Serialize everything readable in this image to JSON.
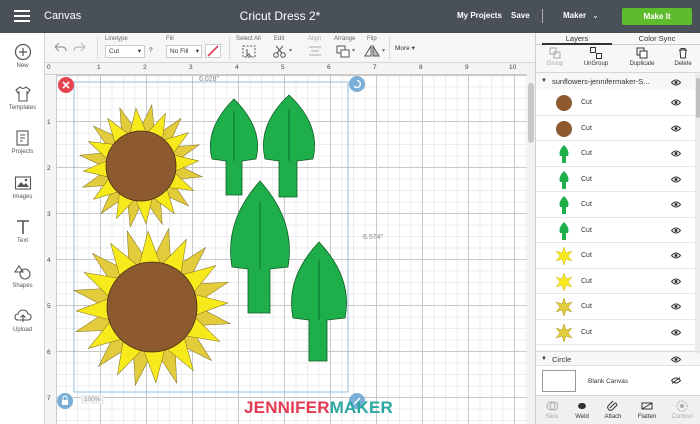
{
  "topbar": {
    "app_title": "Canvas",
    "doc_title": "Cricut Dress 2*",
    "my_projects": "My Projects",
    "save": "Save",
    "machine": "Maker",
    "make_it": "Make It"
  },
  "left_tools": [
    {
      "label": "New",
      "icon": "plus-circle-icon"
    },
    {
      "label": "Templates",
      "icon": "shirt-icon"
    },
    {
      "label": "Projects",
      "icon": "projects-icon"
    },
    {
      "label": "Images",
      "icon": "image-icon"
    },
    {
      "label": "Text",
      "icon": "text-icon"
    },
    {
      "label": "Shapes",
      "icon": "shapes-icon"
    },
    {
      "label": "Upload",
      "icon": "upload-icon"
    }
  ],
  "edit_bar": {
    "linetype_label": "Linetype",
    "linetype_value": "Cut",
    "help": "?",
    "fill_label": "Fill",
    "fill_value": "No Fill",
    "select_all_label": "Select All",
    "edit_label": "Edit",
    "align_label": "Align",
    "arrange_label": "Arrange",
    "flip_label": "Flip",
    "more_label": "More"
  },
  "ruler": {
    "top": [
      "1",
      "2",
      "3",
      "4",
      "5",
      "6",
      "7",
      "8",
      "9",
      "10"
    ],
    "left": [
      "0",
      "1",
      "2",
      "3",
      "4",
      "5",
      "6",
      "7"
    ]
  },
  "canvas": {
    "width_label": "6.028\"",
    "height_label": "6.574\"",
    "zoom": "100%"
  },
  "right_panel": {
    "tabs": [
      "Layers",
      "Color Sync"
    ],
    "actions": [
      "Group",
      "UnGroup",
      "Duplicate",
      "Delete"
    ],
    "group_name": "sunflowers-jennifermaker-S...",
    "layers": [
      {
        "name": "Cut",
        "thumb": "brown-circle"
      },
      {
        "name": "Cut",
        "thumb": "brown-circle"
      },
      {
        "name": "Cut",
        "thumb": "green-leaf"
      },
      {
        "name": "Cut",
        "thumb": "green-leaf"
      },
      {
        "name": "Cut",
        "thumb": "green-leaf"
      },
      {
        "name": "Cut",
        "thumb": "green-leaf"
      },
      {
        "name": "Cut",
        "thumb": "yellow-flower"
      },
      {
        "name": "Cut",
        "thumb": "yellow-flower"
      },
      {
        "name": "Cut",
        "thumb": "yellow-flower"
      },
      {
        "name": "Cut",
        "thumb": "yellow-flower"
      }
    ],
    "circle_group": "Circle",
    "blank_canvas": "Blank Canvas",
    "bottom_actions": [
      "Slice",
      "Weld",
      "Attach",
      "Flatten",
      "Contour"
    ]
  },
  "watermark": {
    "part_a": "JENNIFER",
    "part_b": "MAKER"
  },
  "colors": {
    "topbar": "#4a5058",
    "make_it": "#5dbb2c",
    "petal_yellow": "#f7ea1c",
    "petal_dark": "#e3cc3c",
    "center_brown": "#8c5a2e",
    "leaf_green": "#1eae4a",
    "delete_red": "#e5434f",
    "rotate_blue": "#7aaed6"
  }
}
